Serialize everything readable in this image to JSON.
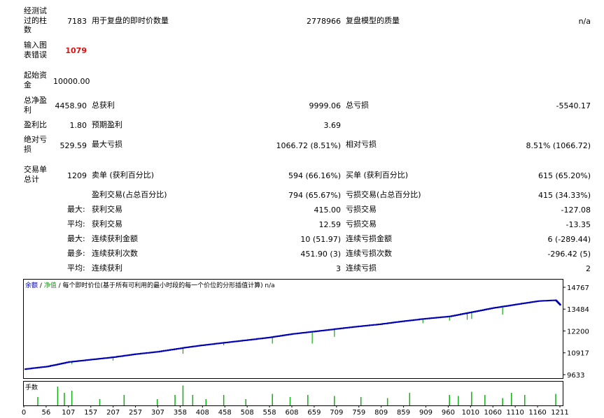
{
  "stats": {
    "bars_label": "经测试过的柱数",
    "bars_value": "7183",
    "ticks_label": "用于复盘的即时价数量",
    "ticks_value": "2778966",
    "quality_label": "复盘模型的质量",
    "quality_value": "n/a",
    "errors_label": "输入图表错误",
    "errors_value": "1079",
    "deposit_label": "起始资金",
    "deposit_value": "10000.00",
    "net_profit_label": "总净盈利",
    "net_profit_value": "4458.90",
    "gross_profit_label": "总获利",
    "gross_profit_value": "9999.06",
    "gross_loss_label": "总亏损",
    "gross_loss_value": "-5540.17",
    "profit_factor_label": "盈利比",
    "profit_factor_value": "1.80",
    "expected_payoff_label": "预期盈利",
    "expected_payoff_value": "3.69",
    "abs_drawdown_label": "绝对亏损",
    "abs_drawdown_value": "529.59",
    "max_drawdown_label": "最大亏损",
    "max_drawdown_value": "1066.72 (8.51%)",
    "rel_drawdown_label": "相对亏损",
    "rel_drawdown_value": "8.51% (1066.72)",
    "total_trades_label": "交易单总计",
    "total_trades_value": "1209",
    "short_label": "卖单 (获利百分比)",
    "short_value": "594 (66.16%)",
    "long_label": "买单 (获利百分比)",
    "long_value": "615 (65.20%)",
    "profit_trades_label": "盈利交易(占总百分比)",
    "profit_trades_value": "794 (65.67%)",
    "loss_trades_label": "亏损交易(占总百分比)",
    "loss_trades_value": "415 (34.33%)",
    "largest_prefix": "最大:",
    "largest_profit_label": "获利交易",
    "largest_profit_value": "415.00",
    "largest_loss_label": "亏损交易",
    "largest_loss_value": "-127.08",
    "average_prefix": "平均:",
    "average_profit_label": "获利交易",
    "average_profit_value": "12.59",
    "average_loss_label": "亏损交易",
    "average_loss_value": "-13.35",
    "max_prefix": "最大:",
    "max_cons_wins_money_label": "连续获利金额",
    "max_cons_wins_money_value": "10 (51.97)",
    "max_cons_losses_money_label": "连续亏损金额",
    "max_cons_losses_money_value": "6 (-289.44)",
    "most_prefix": "最多:",
    "max_cons_profit_label": "连续获利次数",
    "max_cons_profit_value": "451.90 (3)",
    "max_cons_loss_label": "连续亏损次数",
    "max_cons_loss_value": "-296.42 (5)",
    "avg_prefix": "平均:",
    "avg_cons_wins_label": "连续获利",
    "avg_cons_wins_value": "3",
    "avg_cons_losses_label": "连续亏损",
    "avg_cons_losses_value": "2"
  },
  "chart_header": {
    "balance": "余额",
    "sep1": " / ",
    "equity": "净值",
    "rest": " / 每个即时价位(基于所有可利用的最小时段的每一个价位的分形插值计算)  n/a"
  },
  "volume_label": "手数",
  "colors": {
    "balance": "#0000b0",
    "equity": "#10b010",
    "volume": "#10b010"
  },
  "chart_data": {
    "type": "line",
    "yticks": [
      "14767",
      "13484",
      "12200",
      "10917",
      "9633"
    ],
    "xticks": [
      "0",
      "56",
      "107",
      "157",
      "207",
      "257",
      "307",
      "358",
      "408",
      "458",
      "508",
      "558",
      "608",
      "659",
      "709",
      "759",
      "809",
      "859",
      "909",
      "960",
      "1010",
      "1060",
      "1110",
      "1160",
      "1211"
    ],
    "ylim": [
      9633,
      14767
    ],
    "xlim": [
      0,
      1211
    ],
    "balance": [
      [
        0,
        10000
      ],
      [
        50,
        10150
      ],
      [
        100,
        10420
      ],
      [
        150,
        10560
      ],
      [
        200,
        10700
      ],
      [
        250,
        10880
      ],
      [
        300,
        11020
      ],
      [
        358,
        11250
      ],
      [
        400,
        11400
      ],
      [
        450,
        11550
      ],
      [
        500,
        11700
      ],
      [
        550,
        11850
      ],
      [
        600,
        12050
      ],
      [
        650,
        12200
      ],
      [
        700,
        12350
      ],
      [
        750,
        12500
      ],
      [
        800,
        12630
      ],
      [
        850,
        12800
      ],
      [
        900,
        12950
      ],
      [
        960,
        13100
      ],
      [
        1010,
        13350
      ],
      [
        1060,
        13600
      ],
      [
        1110,
        13800
      ],
      [
        1160,
        14000
      ],
      [
        1200,
        14050
      ],
      [
        1211,
        13750
      ]
    ],
    "equity_dips": [
      [
        107,
        10300
      ],
      [
        200,
        10500
      ],
      [
        358,
        10900
      ],
      [
        450,
        11400
      ],
      [
        560,
        11500
      ],
      [
        650,
        11500
      ],
      [
        700,
        11900
      ],
      [
        900,
        12700
      ],
      [
        960,
        12850
      ],
      [
        1000,
        12900
      ],
      [
        1010,
        12950
      ],
      [
        1080,
        13200
      ]
    ],
    "volume_spikes": [
      [
        30,
        0.4
      ],
      [
        75,
        0.9
      ],
      [
        90,
        0.6
      ],
      [
        107,
        0.7
      ],
      [
        170,
        0.3
      ],
      [
        225,
        0.5
      ],
      [
        300,
        0.3
      ],
      [
        340,
        0.5
      ],
      [
        358,
        0.95
      ],
      [
        380,
        0.5
      ],
      [
        410,
        0.3
      ],
      [
        450,
        0.5
      ],
      [
        500,
        0.3
      ],
      [
        560,
        0.55
      ],
      [
        600,
        0.4
      ],
      [
        640,
        0.5
      ],
      [
        700,
        0.45
      ],
      [
        760,
        0.4
      ],
      [
        820,
        0.35
      ],
      [
        870,
        0.6
      ],
      [
        960,
        0.5
      ],
      [
        980,
        0.45
      ],
      [
        1010,
        0.65
      ],
      [
        1040,
        0.5
      ],
      [
        1080,
        0.35
      ],
      [
        1100,
        0.6
      ],
      [
        1130,
        0.5
      ],
      [
        1200,
        0.55
      ]
    ]
  }
}
